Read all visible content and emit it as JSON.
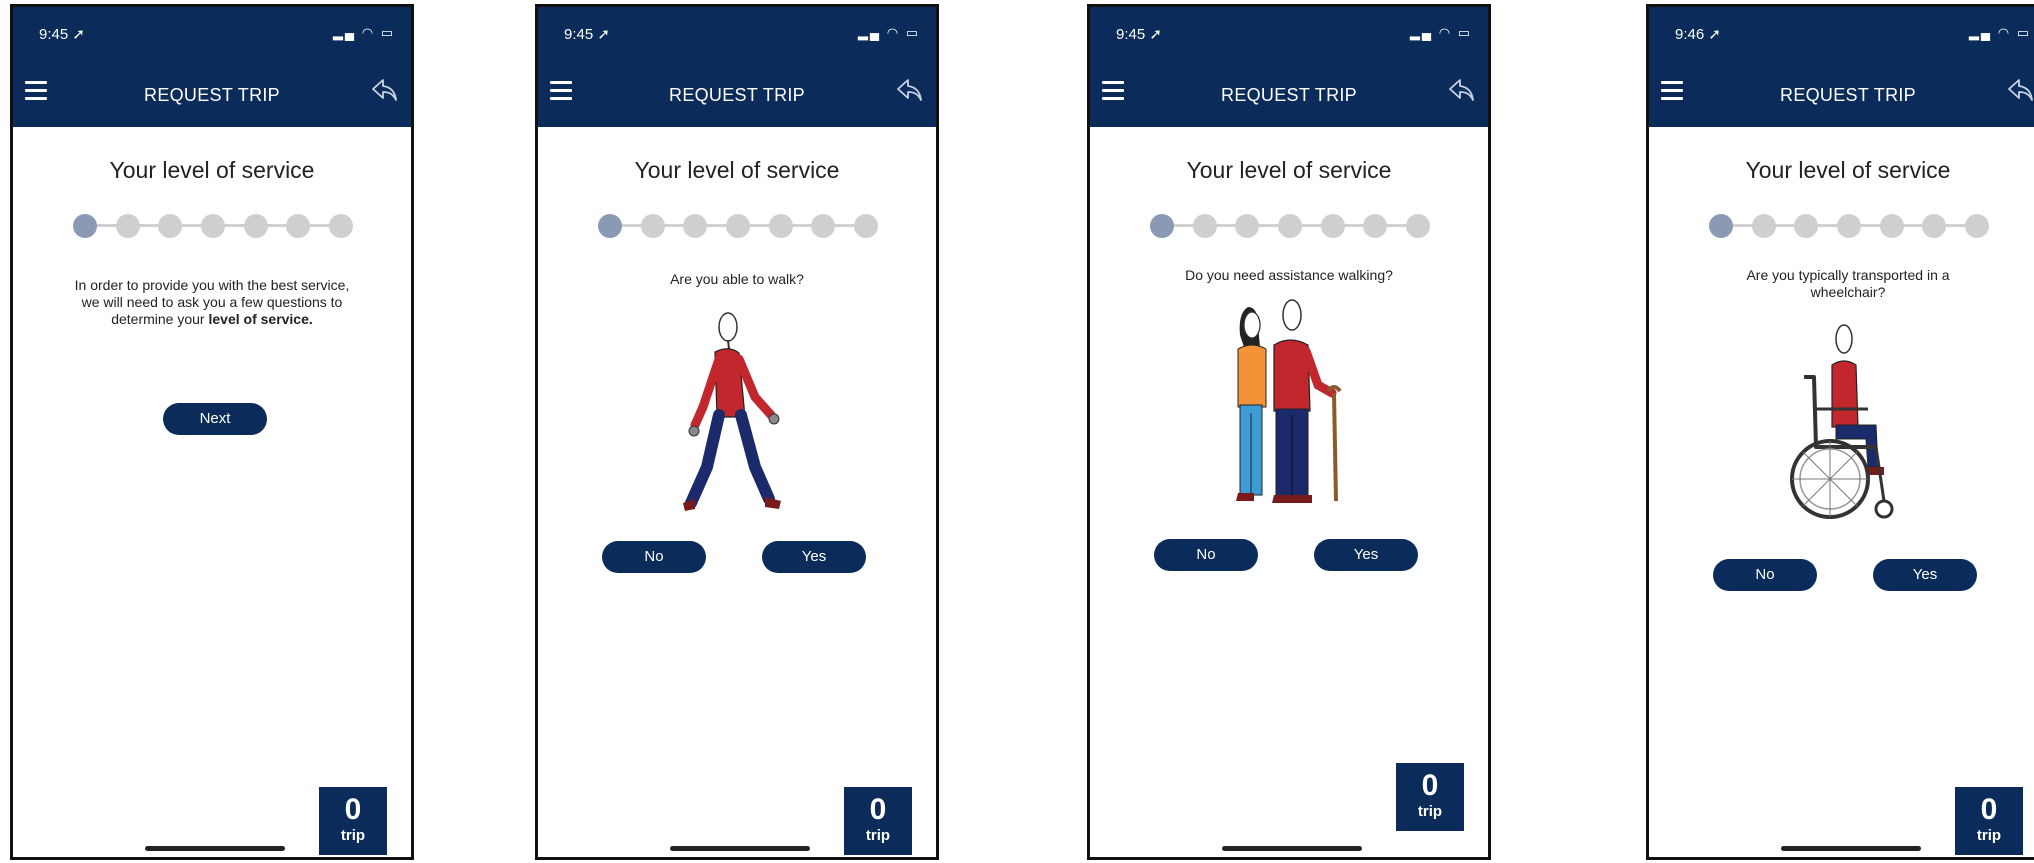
{
  "screens": [
    {
      "status_time": "9:45",
      "nav_title": "REQUEST TRIP",
      "heading": "Your level of service",
      "intro_text": "In order to provide you with the best service, we will need to ask you a few questions to determine your",
      "intro_bold": "level of service.",
      "next_label": "Next",
      "trip_count": "0",
      "trip_label": "trip"
    },
    {
      "status_time": "9:45",
      "nav_title": "REQUEST TRIP",
      "heading": "Your level of service",
      "question": "Are you able to walk?",
      "no_label": "No",
      "yes_label": "Yes",
      "trip_count": "0",
      "trip_label": "trip"
    },
    {
      "status_time": "9:45",
      "nav_title": "REQUEST TRIP",
      "heading": "Your level of service",
      "question": "Do you need assistance walking?",
      "no_label": "No",
      "yes_label": "Yes",
      "trip_count": "0",
      "trip_label": "trip"
    },
    {
      "status_time": "9:46",
      "nav_title": "REQUEST TRIP",
      "heading": "Your level of service",
      "question": "Are you typically transported in a wheelchair?",
      "no_label": "No",
      "yes_label": "Yes",
      "trip_count": "0",
      "trip_label": "trip"
    }
  ],
  "progress": {
    "current_step": 1,
    "total_steps": 7
  },
  "colors": {
    "navy": "#0b2c5a",
    "dot_active": "#8a9ab4",
    "dot_inactive": "#cfcfcf"
  },
  "icons": [
    "menu-icon",
    "back-arrow-icon",
    "location-arrow-icon",
    "signal-icon",
    "wifi-icon",
    "battery-icon"
  ]
}
